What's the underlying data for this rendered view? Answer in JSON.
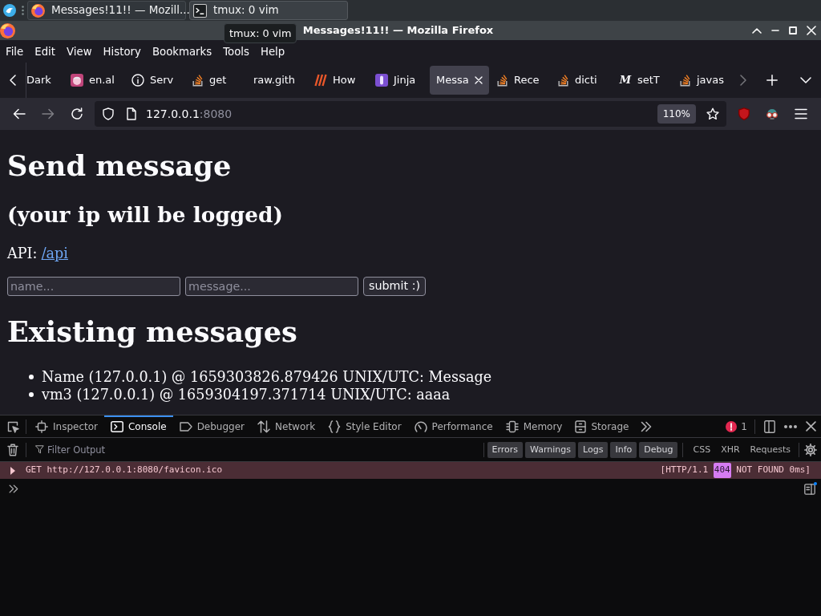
{
  "taskbar": {
    "tasks": [
      {
        "kind": "browser",
        "title": "Messages!11!! — Mozill...",
        "selected": true
      },
      {
        "kind": "terminal",
        "title": "tmux: 0 vim",
        "selected": false
      }
    ]
  },
  "tooltip": {
    "text": "tmux: 0 vim"
  },
  "window": {
    "title": "Messages!11!! — Mozilla Firefox"
  },
  "menu": [
    "File",
    "Edit",
    "View",
    "History",
    "Bookmarks",
    "Tools",
    "Help"
  ],
  "tab_scroll": [
    {
      "kind": "left",
      "disabled": false
    },
    {
      "kind": "right",
      "disabled": true
    }
  ],
  "tabs": [
    {
      "kind": "plain",
      "label": "Dark",
      "selected": false
    },
    {
      "kind": "avatar",
      "label": "en.al",
      "selected": false
    },
    {
      "kind": "info",
      "label": "Serv",
      "selected": false
    },
    {
      "kind": "stack",
      "label": "get",
      "selected": false
    },
    {
      "kind": "plain",
      "label": "raw.gith",
      "selected": false
    },
    {
      "kind": "slashes",
      "label": "How",
      "selected": false
    },
    {
      "kind": "tile",
      "label": "Jinja",
      "selected": false
    },
    {
      "kind": "plain",
      "label": "Messa",
      "selected": true
    },
    {
      "kind": "stack",
      "label": "Rece",
      "selected": false
    },
    {
      "kind": "stack",
      "label": "dicti",
      "selected": false
    },
    {
      "kind": "letter",
      "icon_text": "M",
      "label": "setT",
      "selected": false
    },
    {
      "kind": "stack",
      "label": "javas",
      "selected": false
    }
  ],
  "navigation": [
    {
      "kind": "back",
      "disabled": false
    },
    {
      "kind": "forward",
      "disabled": true
    },
    {
      "kind": "reload",
      "disabled": false
    }
  ],
  "address": {
    "host": "127.0.0.1",
    "port": ":8080",
    "zoom": "110%"
  },
  "page": {
    "title": "Send message",
    "subtitle": "(your ip will be logged)",
    "api_label": "API:",
    "api_link": "/api",
    "fields": [
      {
        "placeholder": "name..."
      },
      {
        "placeholder": "message..."
      }
    ],
    "submit": "submit :)",
    "messages_title": "Existing messages",
    "messages": [
      "Name (127.0.0.1) @ 1659303826.879426 UNIX/UTC: Message",
      "vm3 (127.0.0.1) @ 1659304197.371714 UNIX/UTC: aaaa"
    ]
  },
  "devtools": {
    "tabs": [
      {
        "kind": "inspector",
        "label": "Inspector",
        "selected": false
      },
      {
        "kind": "console",
        "label": "Console",
        "selected": true
      },
      {
        "kind": "debugger",
        "label": "Debugger",
        "selected": false
      },
      {
        "kind": "network",
        "label": "Network",
        "selected": false
      },
      {
        "kind": "style",
        "label": "Style Editor",
        "selected": false
      },
      {
        "kind": "performance",
        "label": "Performance",
        "selected": false
      },
      {
        "kind": "memory",
        "label": "Memory",
        "selected": false
      },
      {
        "kind": "storage",
        "label": "Storage",
        "selected": false
      }
    ],
    "error_count": "1",
    "filter": {
      "placeholder": "Filter Output"
    },
    "levels": [
      {
        "label": "Errors",
        "selected": true
      },
      {
        "label": "Warnings",
        "selected": true
      },
      {
        "label": "Logs",
        "selected": true
      },
      {
        "label": "Info",
        "selected": true
      },
      {
        "label": "Debug",
        "selected": true
      }
    ],
    "types": [
      {
        "label": "CSS",
        "selected": false
      },
      {
        "label": "XHR",
        "selected": false
      },
      {
        "label": "Requests",
        "selected": false
      }
    ],
    "log": [
      {
        "kind": "error",
        "text": "GET http://127.0.0.1:8080/favicon.ico",
        "protocol": "[HTTP/1.1",
        "status": "404",
        "status_text": "NOT FOUND 0ms]"
      }
    ]
  }
}
